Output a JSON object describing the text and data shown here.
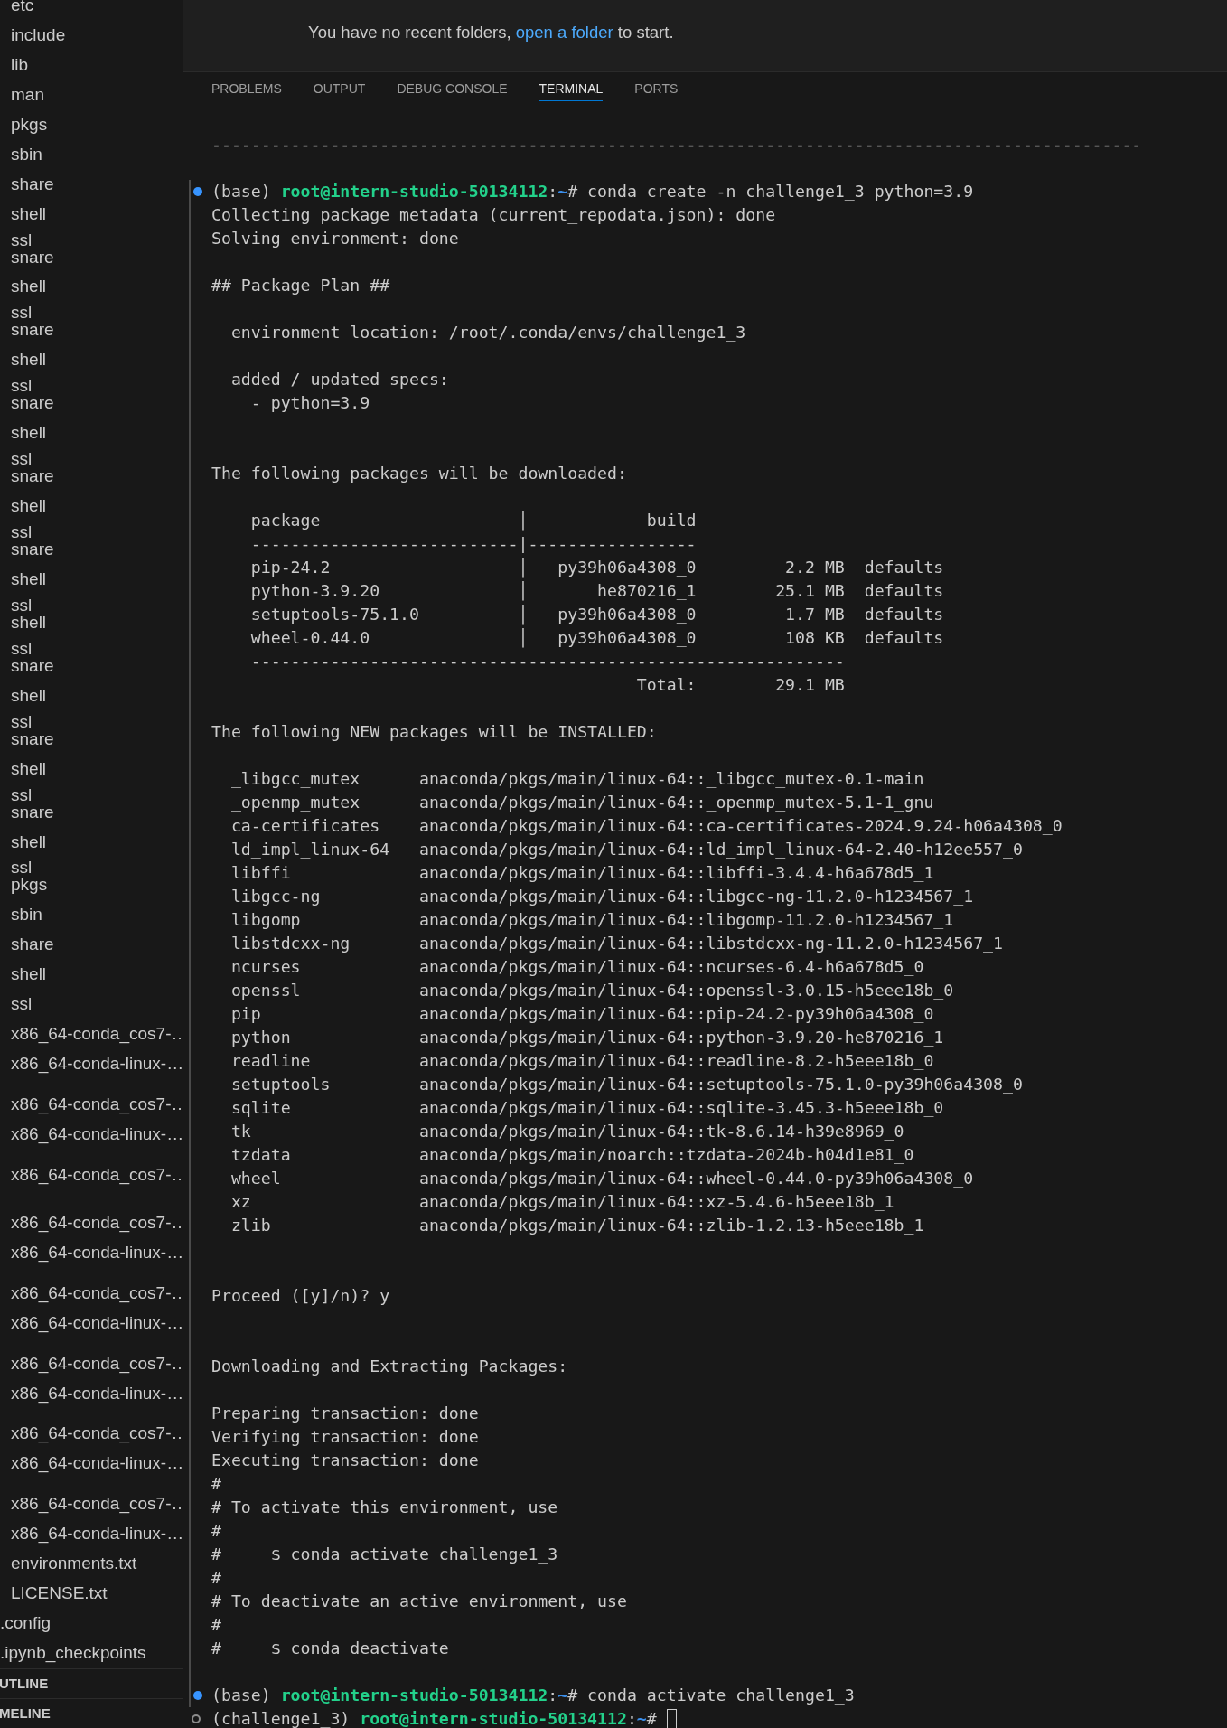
{
  "sidebar": {
    "items": [
      {
        "label": "etc",
        "kind": "row"
      },
      {
        "label": "include",
        "kind": "row"
      },
      {
        "label": "lib",
        "kind": "row"
      },
      {
        "label": "man",
        "kind": "row"
      },
      {
        "label": "pkgs",
        "kind": "row"
      },
      {
        "label": "sbin",
        "kind": "row"
      },
      {
        "label": "share",
        "kind": "row"
      },
      {
        "label": "shell",
        "kind": "row"
      },
      {
        "label": "ssl",
        "kind": "squeezed"
      },
      {
        "label": "snare",
        "kind": "row"
      },
      {
        "label": "shell",
        "kind": "row"
      },
      {
        "label": "ssl",
        "kind": "squeezed"
      },
      {
        "label": "snare",
        "kind": "row"
      },
      {
        "label": "shell",
        "kind": "row"
      },
      {
        "label": "ssl",
        "kind": "squeezed"
      },
      {
        "label": "snare",
        "kind": "row"
      },
      {
        "label": "shell",
        "kind": "row"
      },
      {
        "label": "ssl",
        "kind": "squeezed"
      },
      {
        "label": "snare",
        "kind": "row"
      },
      {
        "label": "shell",
        "kind": "row"
      },
      {
        "label": "ssl",
        "kind": "squeezed"
      },
      {
        "label": "snare",
        "kind": "row"
      },
      {
        "label": "shell",
        "kind": "row"
      },
      {
        "label": "ssl",
        "kind": "squeezed"
      },
      {
        "label": "shell",
        "kind": "row"
      },
      {
        "label": "ssl",
        "kind": "squeezed"
      },
      {
        "label": "snare",
        "kind": "row"
      },
      {
        "label": "shell",
        "kind": "row"
      },
      {
        "label": "ssl",
        "kind": "squeezed"
      },
      {
        "label": "snare",
        "kind": "row"
      },
      {
        "label": "shell",
        "kind": "row"
      },
      {
        "label": "ssl",
        "kind": "squeezed"
      },
      {
        "label": "snare",
        "kind": "row"
      },
      {
        "label": "shell",
        "kind": "row"
      },
      {
        "label": "ssl",
        "kind": "squeezed"
      },
      {
        "label": "pkgs",
        "kind": "row"
      },
      {
        "label": "sbin",
        "kind": "row"
      },
      {
        "label": "share",
        "kind": "row"
      },
      {
        "label": "shell",
        "kind": "row"
      },
      {
        "label": "ssl",
        "kind": "row"
      },
      {
        "label": "x86_64-conda_cos7-…",
        "kind": "row"
      },
      {
        "label": "x86_64-conda-linux-…",
        "kind": "row"
      },
      {
        "label": "x86_64-conda_cos7-…",
        "kind": "spaced"
      },
      {
        "label": "x86_64-conda-linux-…",
        "kind": "row"
      },
      {
        "label": "x86_64-conda_cos7-…",
        "kind": "spaced"
      },
      {
        "label": "x86_64-conda_cos7-…",
        "kind": "wide"
      },
      {
        "label": "x86_64-conda-linux-…",
        "kind": "row"
      },
      {
        "label": "x86_64-conda_cos7-…",
        "kind": "spaced"
      },
      {
        "label": "x86_64-conda-linux-…",
        "kind": "row"
      },
      {
        "label": "x86_64-conda_cos7-…",
        "kind": "spaced"
      },
      {
        "label": "x86_64-conda-linux-…",
        "kind": "row"
      },
      {
        "label": "x86_64-conda_cos7-…",
        "kind": "spaced"
      },
      {
        "label": "x86_64-conda-linux-…",
        "kind": "row"
      },
      {
        "label": "x86_64-conda_cos7-…",
        "kind": "spaced"
      },
      {
        "label": "x86_64-conda-linux-…",
        "kind": "row"
      },
      {
        "label": "environments.txt",
        "kind": "row"
      },
      {
        "label": "LICENSE.txt",
        "kind": "row"
      },
      {
        "label": ".config",
        "kind": "outdented"
      },
      {
        "label": ".ipynb_checkpoints",
        "kind": "outdented"
      }
    ],
    "sections": [
      {
        "label": "UTLINE"
      },
      {
        "label": "MELINE"
      }
    ]
  },
  "welcome": {
    "message_before": "You have no recent folders, ",
    "link": "open a folder",
    "message_after": " to start."
  },
  "panel": {
    "tabs": [
      {
        "label": "PROBLEMS",
        "selected": false
      },
      {
        "label": "OUTPUT",
        "selected": false
      },
      {
        "label": "DEBUG CONSOLE",
        "selected": false
      },
      {
        "label": "TERMINAL",
        "selected": true
      },
      {
        "label": "PORTS",
        "selected": false
      }
    ]
  },
  "terminal": {
    "lines": [
      {
        "kind": "text",
        "text": "----------------------------------------------------------------------------------------------"
      },
      {
        "kind": "blank"
      },
      {
        "kind": "prompt",
        "completed": true,
        "env": "(base)",
        "user": "root@intern-studio-50134112",
        "separator": ":",
        "path": "~",
        "symbol": "#",
        "command": "conda create -n challenge1_3 python=3.9",
        "cursor": false
      },
      {
        "kind": "text",
        "text": "Collecting package metadata (current_repodata.json): done"
      },
      {
        "kind": "text",
        "text": "Solving environment: done"
      },
      {
        "kind": "blank"
      },
      {
        "kind": "text",
        "text": "## Package Plan ##"
      },
      {
        "kind": "blank"
      },
      {
        "kind": "text",
        "text": "  environment location: /root/.conda/envs/challenge1_3"
      },
      {
        "kind": "blank"
      },
      {
        "kind": "text",
        "text": "  added / updated specs:"
      },
      {
        "kind": "text",
        "text": "    - python=3.9"
      },
      {
        "kind": "blank"
      },
      {
        "kind": "blank"
      },
      {
        "kind": "text",
        "text": "The following packages will be downloaded:"
      },
      {
        "kind": "blank"
      },
      {
        "kind": "text",
        "text": "    package                    │            build"
      },
      {
        "kind": "text",
        "text": "    ---------------------------|-----------------"
      },
      {
        "kind": "text",
        "text": "    pip-24.2                   │   py39h06a4308_0         2.2 MB  defaults"
      },
      {
        "kind": "text",
        "text": "    python-3.9.20              │       he870216_1        25.1 MB  defaults"
      },
      {
        "kind": "text",
        "text": "    setuptools-75.1.0          │   py39h06a4308_0         1.7 MB  defaults"
      },
      {
        "kind": "text",
        "text": "    wheel-0.44.0               │   py39h06a4308_0         108 KB  defaults"
      },
      {
        "kind": "text",
        "text": "    ------------------------------------------------------------"
      },
      {
        "kind": "text",
        "text": "                                           Total:        29.1 MB"
      },
      {
        "kind": "blank"
      },
      {
        "kind": "text",
        "text": "The following NEW packages will be INSTALLED:"
      },
      {
        "kind": "blank"
      },
      {
        "kind": "text",
        "text": "  _libgcc_mutex      anaconda/pkgs/main/linux-64::_libgcc_mutex-0.1-main"
      },
      {
        "kind": "text",
        "text": "  _openmp_mutex      anaconda/pkgs/main/linux-64::_openmp_mutex-5.1-1_gnu"
      },
      {
        "kind": "text",
        "text": "  ca-certificates    anaconda/pkgs/main/linux-64::ca-certificates-2024.9.24-h06a4308_0"
      },
      {
        "kind": "text",
        "text": "  ld_impl_linux-64   anaconda/pkgs/main/linux-64::ld_impl_linux-64-2.40-h12ee557_0"
      },
      {
        "kind": "text",
        "text": "  libffi             anaconda/pkgs/main/linux-64::libffi-3.4.4-h6a678d5_1"
      },
      {
        "kind": "text",
        "text": "  libgcc-ng          anaconda/pkgs/main/linux-64::libgcc-ng-11.2.0-h1234567_1"
      },
      {
        "kind": "text",
        "text": "  libgomp            anaconda/pkgs/main/linux-64::libgomp-11.2.0-h1234567_1"
      },
      {
        "kind": "text",
        "text": "  libstdcxx-ng       anaconda/pkgs/main/linux-64::libstdcxx-ng-11.2.0-h1234567_1"
      },
      {
        "kind": "text",
        "text": "  ncurses            anaconda/pkgs/main/linux-64::ncurses-6.4-h6a678d5_0"
      },
      {
        "kind": "text",
        "text": "  openssl            anaconda/pkgs/main/linux-64::openssl-3.0.15-h5eee18b_0"
      },
      {
        "kind": "text",
        "text": "  pip                anaconda/pkgs/main/linux-64::pip-24.2-py39h06a4308_0"
      },
      {
        "kind": "text",
        "text": "  python             anaconda/pkgs/main/linux-64::python-3.9.20-he870216_1"
      },
      {
        "kind": "text",
        "text": "  readline           anaconda/pkgs/main/linux-64::readline-8.2-h5eee18b_0"
      },
      {
        "kind": "text",
        "text": "  setuptools         anaconda/pkgs/main/linux-64::setuptools-75.1.0-py39h06a4308_0"
      },
      {
        "kind": "text",
        "text": "  sqlite             anaconda/pkgs/main/linux-64::sqlite-3.45.3-h5eee18b_0"
      },
      {
        "kind": "text",
        "text": "  tk                 anaconda/pkgs/main/linux-64::tk-8.6.14-h39e8969_0"
      },
      {
        "kind": "text",
        "text": "  tzdata             anaconda/pkgs/main/noarch::tzdata-2024b-h04d1e81_0"
      },
      {
        "kind": "text",
        "text": "  wheel              anaconda/pkgs/main/linux-64::wheel-0.44.0-py39h06a4308_0"
      },
      {
        "kind": "text",
        "text": "  xz                 anaconda/pkgs/main/linux-64::xz-5.4.6-h5eee18b_1"
      },
      {
        "kind": "text",
        "text": "  zlib               anaconda/pkgs/main/linux-64::zlib-1.2.13-h5eee18b_1"
      },
      {
        "kind": "blank"
      },
      {
        "kind": "blank"
      },
      {
        "kind": "text",
        "text": "Proceed ([y]/n)? y"
      },
      {
        "kind": "blank"
      },
      {
        "kind": "blank"
      },
      {
        "kind": "text",
        "text": "Downloading and Extracting Packages:"
      },
      {
        "kind": "blank"
      },
      {
        "kind": "text",
        "text": "Preparing transaction: done"
      },
      {
        "kind": "text",
        "text": "Verifying transaction: done"
      },
      {
        "kind": "text",
        "text": "Executing transaction: done"
      },
      {
        "kind": "text",
        "text": "#"
      },
      {
        "kind": "text",
        "text": "# To activate this environment, use"
      },
      {
        "kind": "text",
        "text": "#"
      },
      {
        "kind": "text",
        "text": "#     $ conda activate challenge1_3"
      },
      {
        "kind": "text",
        "text": "#"
      },
      {
        "kind": "text",
        "text": "# To deactivate an active environment, use"
      },
      {
        "kind": "text",
        "text": "#"
      },
      {
        "kind": "text",
        "text": "#     $ conda deactivate"
      },
      {
        "kind": "blank"
      },
      {
        "kind": "prompt",
        "completed": true,
        "env": "(base)",
        "user": "root@intern-studio-50134112",
        "separator": ":",
        "path": "~",
        "symbol": "#",
        "command": "conda activate challenge1_3",
        "cursor": false
      },
      {
        "kind": "prompt",
        "completed": false,
        "env": "(challenge1_3)",
        "user": "root@intern-studio-50134112",
        "separator": ":",
        "path": "~",
        "symbol": "#",
        "cursor": true
      }
    ]
  }
}
